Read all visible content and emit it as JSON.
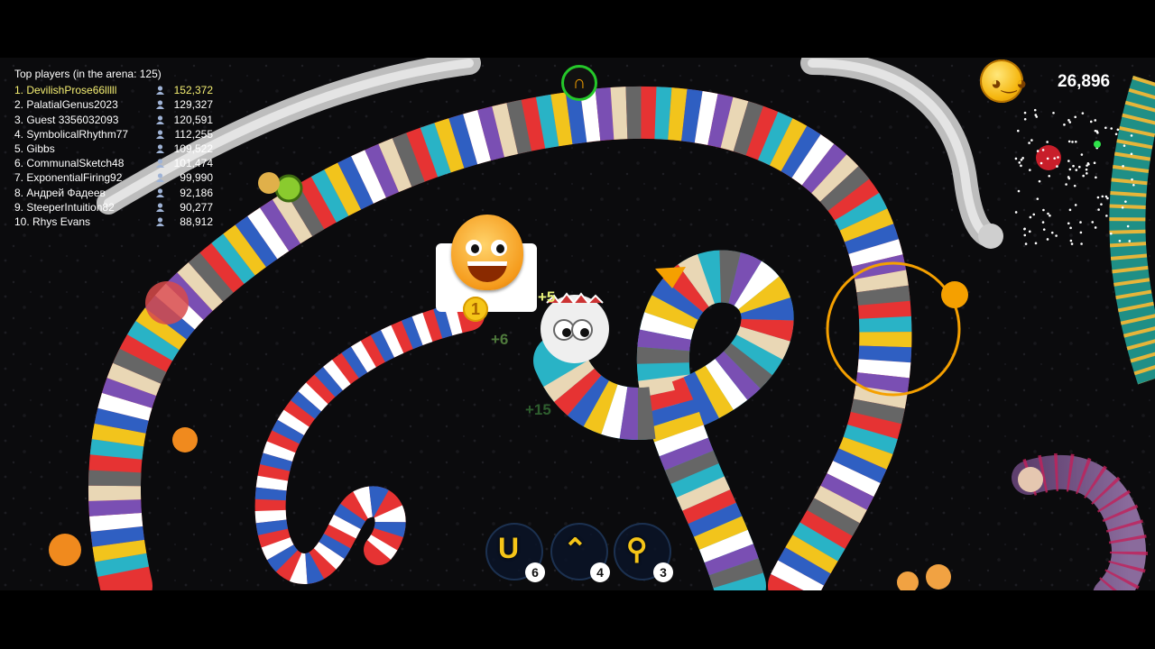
{
  "leaderboard": {
    "title": "Top players (in the arena: 125)",
    "players": [
      {
        "name": "1. DevilishProse66lllll",
        "score": "152,372"
      },
      {
        "name": "2. PalatialGenus2023",
        "score": "129,327"
      },
      {
        "name": "3. Guest 3356032093",
        "score": "120,591"
      },
      {
        "name": "4. SymbolicalRhythm77",
        "score": "112,255"
      },
      {
        "name": "5. Gibbs",
        "score": "109,522"
      },
      {
        "name": "6. CommunalSketch48",
        "score": "101,474"
      },
      {
        "name": "7. ExponentialFiring92",
        "score": "99,990"
      },
      {
        "name": "8. Андрей Фадеев",
        "score": "92,186"
      },
      {
        "name": "9. SteeperIntuition82",
        "score": "90,277"
      },
      {
        "name": "10. Rhys Evans",
        "score": "88,912"
      }
    ]
  },
  "player_score": "26,896",
  "floating_texts": [
    "+5",
    "+6",
    "+15"
  ],
  "sticker_badge": "1",
  "boosts": [
    {
      "icon": "magnet-icon",
      "glyph": "U",
      "count": "6"
    },
    {
      "icon": "speed-icon",
      "glyph": "⌃",
      "count": "4"
    },
    {
      "icon": "zoom-icon",
      "glyph": "⚲",
      "count": "3"
    }
  ],
  "colors": {
    "highlight": "#f4ee72",
    "accent_orange": "#f5a000",
    "magnet_ring": "#25c72a",
    "snake_stripes": [
      "#e63333",
      "#2f5fc2",
      "#ffffff",
      "#f2c41c",
      "#7a4fb3",
      "#29b3c6",
      "#e9d7b5",
      "#666666"
    ]
  }
}
